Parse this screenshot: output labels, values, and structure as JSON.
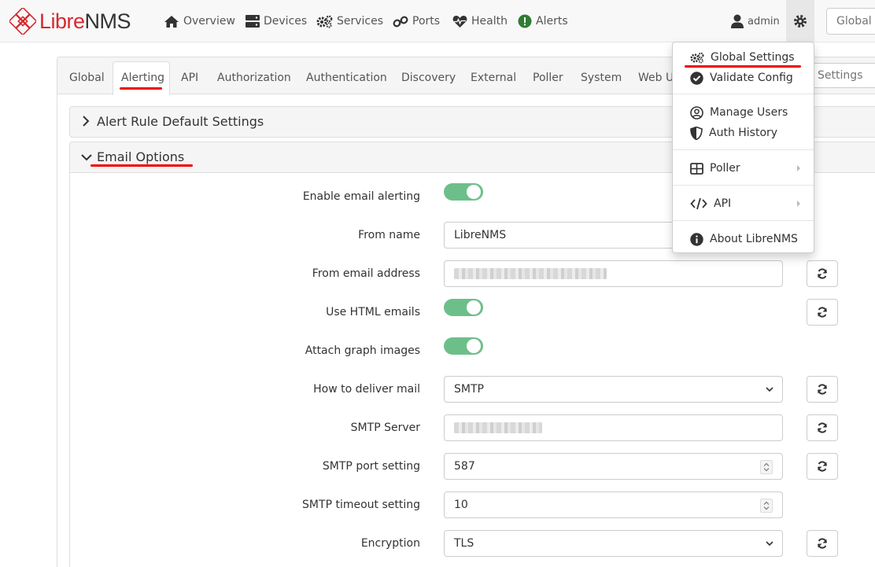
{
  "brand": {
    "part1": "Libre",
    "part2": "NMS"
  },
  "nav": {
    "overview": "Overview",
    "devices": "Devices",
    "services": "Services",
    "ports": "Ports",
    "health": "Health",
    "alerts": "Alerts",
    "user": "admin",
    "search_placeholder": "Global"
  },
  "tabs": [
    "Global",
    "Alerting",
    "API",
    "Authorization",
    "Authentication",
    "Discovery",
    "External",
    "Poller",
    "System",
    "Web U"
  ],
  "active_tab": "Alerting",
  "settings_search_placeholder": "Settings",
  "sections": {
    "alert_rule": "Alert Rule Default Settings",
    "email_options": "Email Options"
  },
  "form": {
    "enable_email": {
      "label": "Enable email alerting",
      "value": true
    },
    "from_name": {
      "label": "From name",
      "value": "LibreNMS"
    },
    "from_email": {
      "label": "From email address"
    },
    "use_html": {
      "label": "Use HTML emails",
      "value": true
    },
    "attach_graph": {
      "label": "Attach graph images",
      "value": true
    },
    "deliver_mail": {
      "label": "How to deliver mail",
      "value": "SMTP"
    },
    "smtp_server": {
      "label": "SMTP Server"
    },
    "smtp_port": {
      "label": "SMTP port setting",
      "value": "587"
    },
    "smtp_timeout": {
      "label": "SMTP timeout setting",
      "value": "10"
    },
    "encryption": {
      "label": "Encryption",
      "value": "TLS"
    }
  },
  "menu": {
    "global_settings": "Global Settings",
    "validate_config": "Validate Config",
    "manage_users": "Manage Users",
    "auth_history": "Auth History",
    "poller": "Poller",
    "api": "API",
    "about": "About LibreNMS"
  },
  "colors": {
    "brand_red": "#d7282f",
    "toggle_on": "#6dbf8a",
    "alerts_green": "#2e7d32",
    "highlight_red": "#ee0000"
  }
}
